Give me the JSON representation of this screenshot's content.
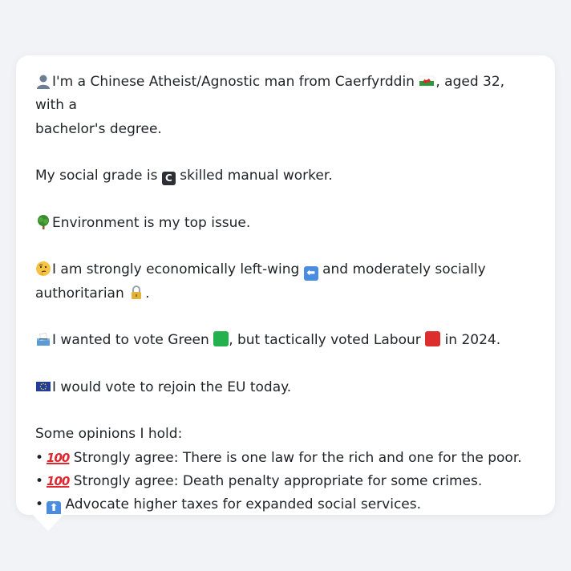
{
  "profile": {
    "identity_text_before_flag": "I'm a Chinese Atheist/Agnostic man from Caerfyrddin",
    "identity_text_after_flag": ", aged 32, with a",
    "identity_text_line2": "bachelor's degree.",
    "social_grade_prefix": "My social grade is",
    "social_grade_badge": "C",
    "social_grade_suffix": "skilled manual worker.",
    "top_issue": "Environment is my top issue.",
    "ideology_part1": "I am strongly economically left-wing",
    "ideology_part2": "and moderately socially",
    "ideology_line2": "authoritarian",
    "ideology_end": ".",
    "vote_part1": "I wanted to vote Green",
    "vote_part2": ", but tactically voted Labour",
    "vote_part3": "in 2024.",
    "eu": "I would vote to rejoin the EU today.",
    "opinions_heading": "Some opinions I hold:",
    "opinions": [
      {
        "bullet": "•",
        "icon": "hundred-points-icon",
        "icon_text": "100",
        "text": "Strongly agree: There is one law for the rich and one for the poor."
      },
      {
        "bullet": "•",
        "icon": "hundred-points-icon",
        "icon_text": "100",
        "text": "Strongly agree: Death penalty appropriate for some crimes."
      },
      {
        "bullet": "•",
        "icon": "up-arrow-icon",
        "icon_text": "⬆",
        "text": "Advocate higher taxes for expanded social services."
      }
    ]
  },
  "icons": {
    "left_arrow_glyph": "⬅",
    "eu_stars_glyph": "★"
  },
  "colors": {
    "background": "#f1f3f6",
    "card": "#ffffff",
    "text": "#1f2328",
    "green_square": "#22b14c",
    "red_square": "#dd2e2e"
  }
}
